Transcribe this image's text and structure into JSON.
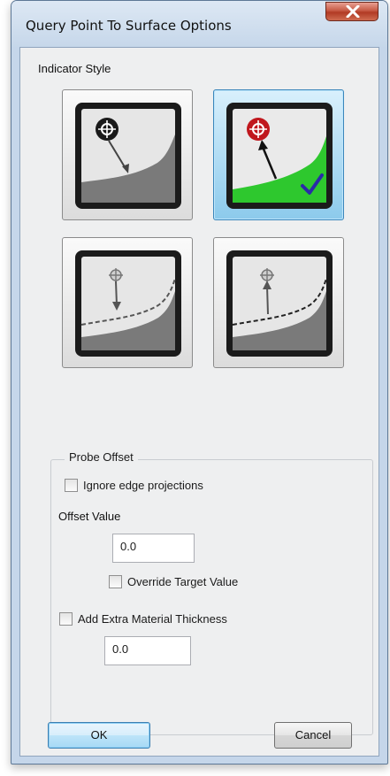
{
  "window": {
    "title": "Query Point To Surface Options",
    "close_icon": "close-x-icon"
  },
  "indicator": {
    "label": "Indicator Style",
    "selected_index": 1,
    "styles": [
      {
        "icon": "arrow-down-to-surface-icon",
        "selected": false
      },
      {
        "icon": "arrow-up-from-surface-green-icon",
        "selected": true
      },
      {
        "icon": "arrow-down-dashed-offset-icon",
        "selected": false
      },
      {
        "icon": "arrow-up-dashed-offset-icon",
        "selected": false
      }
    ],
    "accent_color": "#2ec82e",
    "target_color": "#c0171d"
  },
  "probe_offset": {
    "legend": "Probe Offset",
    "ignore_edge_label": "Ignore edge projections",
    "ignore_edge_checked": false,
    "offset_value_label": "Offset Value",
    "offset_value": "0.0",
    "override_target_label": "Override Target Value",
    "override_target_checked": false,
    "extra_thickness_label": "Add Extra Material Thickness",
    "extra_thickness_checked": false,
    "extra_thickness_value": "0.0"
  },
  "buttons": {
    "ok_label": "OK",
    "cancel_label": "Cancel"
  }
}
